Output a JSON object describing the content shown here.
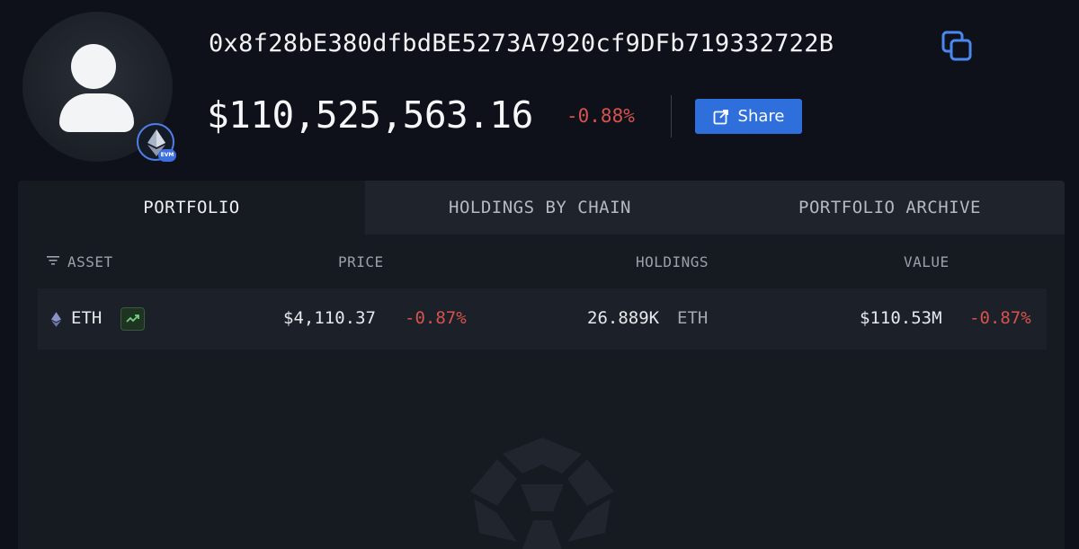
{
  "profile": {
    "address": "0x8f28bE380dfbdBE5273A7920cf9DFb719332722B",
    "badge_label": "EVM",
    "avatar_icon": "user-silhouette-icon",
    "chain_icon": "ethereum-icon",
    "copy_icon": "copy-icon"
  },
  "balance": {
    "total": "$110,525,563.16",
    "change": "-0.88%"
  },
  "share": {
    "label": "Share",
    "icon": "external-link-icon"
  },
  "tabs": [
    {
      "label": "PORTFOLIO",
      "active": true
    },
    {
      "label": "HOLDINGS BY CHAIN",
      "active": false
    },
    {
      "label": "PORTFOLIO ARCHIVE",
      "active": false
    }
  ],
  "table": {
    "headers": {
      "asset": "ASSET",
      "price": "PRICE",
      "holdings": "HOLDINGS",
      "value": "VALUE"
    },
    "rows": [
      {
        "asset": "ETH",
        "price": "$4,110.37",
        "price_change": "-0.87%",
        "holdings": "26.889K",
        "holdings_unit": "ETH",
        "value": "$110.53M",
        "value_change": "-0.87%"
      }
    ]
  },
  "colors": {
    "background": "#0e111a",
    "card": "#161a21",
    "accent": "#2f6fdc",
    "negative": "#d6534d"
  }
}
